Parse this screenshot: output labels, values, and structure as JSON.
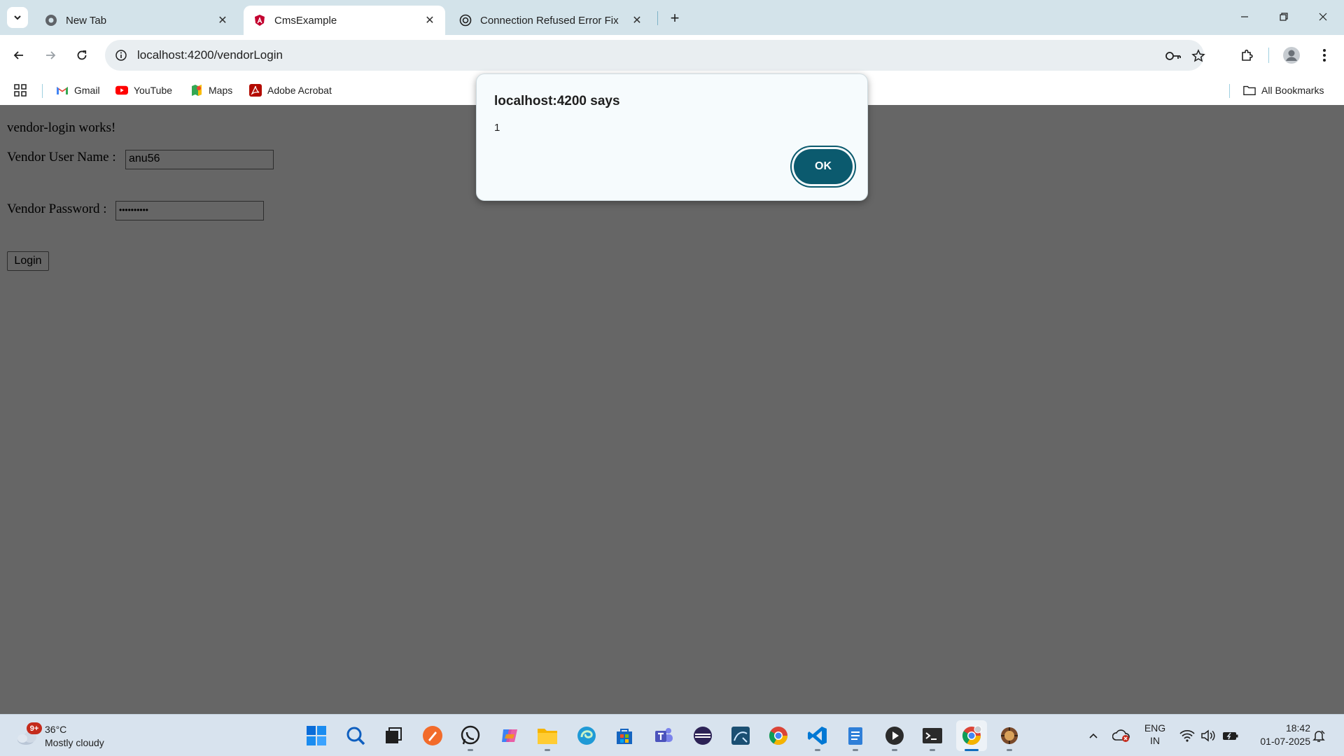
{
  "browser": {
    "tabs": [
      {
        "title": "New Tab",
        "close": "✕"
      },
      {
        "title": "CmsExample",
        "close": "✕"
      },
      {
        "title": "Connection Refused Error Fix",
        "close": "✕"
      }
    ],
    "new_tab": "+",
    "address": "localhost:4200/vendorLogin",
    "bookmarks": [
      {
        "label": "Gmail",
        "icon": "gmail-icon"
      },
      {
        "label": "YouTube",
        "icon": "youtube-icon"
      },
      {
        "label": "Maps",
        "icon": "maps-icon"
      },
      {
        "label": "Adobe Acrobat",
        "icon": "acrobat-icon"
      }
    ],
    "all_bookmarks": "All Bookmarks"
  },
  "page": {
    "heading": "vendor-login works!",
    "username_label": "Vendor User Name :",
    "username_value": "anu56",
    "password_label": "Vendor Password :",
    "password_mask": "••••••••••",
    "login_button": "Login"
  },
  "dialog": {
    "title": "localhost:4200 says",
    "message": "1",
    "ok_label": "OK"
  },
  "taskbar": {
    "weather": {
      "badge": "9+",
      "temp": "36°C",
      "condition": "Mostly cloudy"
    },
    "language": {
      "line1": "ENG",
      "line2": "IN"
    },
    "clock": {
      "time": "18:42",
      "date": "01-07-2025"
    }
  },
  "colors": {
    "tabstrip": "#d3e3ea",
    "page_overlay": "#666666",
    "dialog_button": "#0b5a6e",
    "taskbar": "#d8e3ee"
  }
}
